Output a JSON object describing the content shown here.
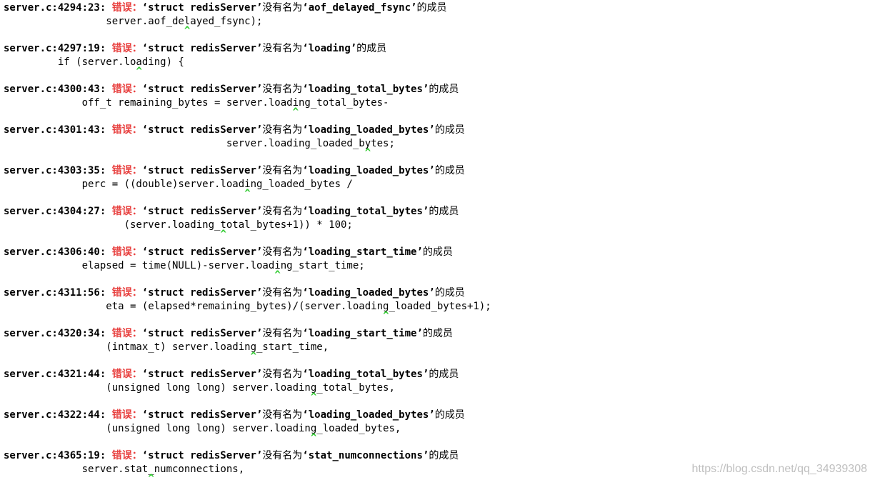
{
  "errors": [
    {
      "location": "server.c:4294:23:",
      "label": "错误：",
      "struct": "‘struct redisServer’",
      "mid": "没有名为",
      "member": "‘aof_delayed_fsync’",
      "tail": "的成员",
      "code": "                 server.aof_delayed_fsync);",
      "caret": "^",
      "caret_col": 23
    },
    {
      "location": "server.c:4297:19:",
      "label": "错误：",
      "struct": "‘struct redisServer’",
      "mid": "没有名为",
      "member": "‘loading’",
      "tail": "的成员",
      "code": "         if (server.loading) {",
      "caret": "^",
      "caret_col": 19
    },
    {
      "location": "server.c:4300:43:",
      "label": "错误：",
      "struct": "‘struct redisServer’",
      "mid": "没有名为",
      "member": "‘loading_total_bytes’",
      "tail": "的成员",
      "code": "             off_t remaining_bytes = server.loading_total_bytes-",
      "caret": "^",
      "caret_col": 43
    },
    {
      "location": "server.c:4301:43:",
      "label": "错误：",
      "struct": "‘struct redisServer’",
      "mid": "没有名为",
      "member": "‘loading_loaded_bytes’",
      "tail": "的成员",
      "code": "                                     server.loading_loaded_bytes;",
      "caret": "^",
      "caret_col": 43
    },
    {
      "location": "server.c:4303:35:",
      "label": "错误：",
      "struct": "‘struct redisServer’",
      "mid": "没有名为",
      "member": "‘loading_loaded_bytes’",
      "tail": "的成员",
      "code": "             perc = ((double)server.loading_loaded_bytes /",
      "caret": "^",
      "caret_col": 35
    },
    {
      "location": "server.c:4304:27:",
      "label": "错误：",
      "struct": "‘struct redisServer’",
      "mid": "没有名为",
      "member": "‘loading_total_bytes’",
      "tail": "的成员",
      "code": "                    (server.loading_total_bytes+1)) * 100;",
      "caret": "^",
      "caret_col": 27
    },
    {
      "location": "server.c:4306:40:",
      "label": "错误：",
      "struct": "‘struct redisServer’",
      "mid": "没有名为",
      "member": "‘loading_start_time’",
      "tail": "的成员",
      "code": "             elapsed = time(NULL)-server.loading_start_time;",
      "caret": "^",
      "caret_col": 40
    },
    {
      "location": "server.c:4311:56:",
      "label": "错误：",
      "struct": "‘struct redisServer’",
      "mid": "没有名为",
      "member": "‘loading_loaded_bytes’",
      "tail": "的成员",
      "code": "                 eta = (elapsed*remaining_bytes)/(server.loading_loaded_bytes+1);",
      "caret": "^",
      "caret_col": 56
    },
    {
      "location": "server.c:4320:34:",
      "label": "错误：",
      "struct": "‘struct redisServer’",
      "mid": "没有名为",
      "member": "‘loading_start_time’",
      "tail": "的成员",
      "code": "                 (intmax_t) server.loading_start_time,",
      "caret": "^",
      "caret_col": 34
    },
    {
      "location": "server.c:4321:44:",
      "label": "错误：",
      "struct": "‘struct redisServer’",
      "mid": "没有名为",
      "member": "‘loading_total_bytes’",
      "tail": "的成员",
      "code": "                 (unsigned long long) server.loading_total_bytes,",
      "caret": "^",
      "caret_col": 44
    },
    {
      "location": "server.c:4322:44:",
      "label": "错误：",
      "struct": "‘struct redisServer’",
      "mid": "没有名为",
      "member": "‘loading_loaded_bytes’",
      "tail": "的成员",
      "code": "                 (unsigned long long) server.loading_loaded_bytes,",
      "caret": "^",
      "caret_col": 44
    },
    {
      "location": "server.c:4365:19:",
      "label": "错误：",
      "struct": "‘struct redisServer’",
      "mid": "没有名为",
      "member": "‘stat_numconnections’",
      "tail": "的成员",
      "code": "             server.stat_numconnections,",
      "caret": "^",
      "caret_col": 19
    }
  ],
  "watermark": "https://blog.csdn.net/qq_34939308",
  "colors": {
    "error_label": "#e8403f",
    "caret": "#33cc33",
    "text": "#000000",
    "background": "#ffffff"
  }
}
